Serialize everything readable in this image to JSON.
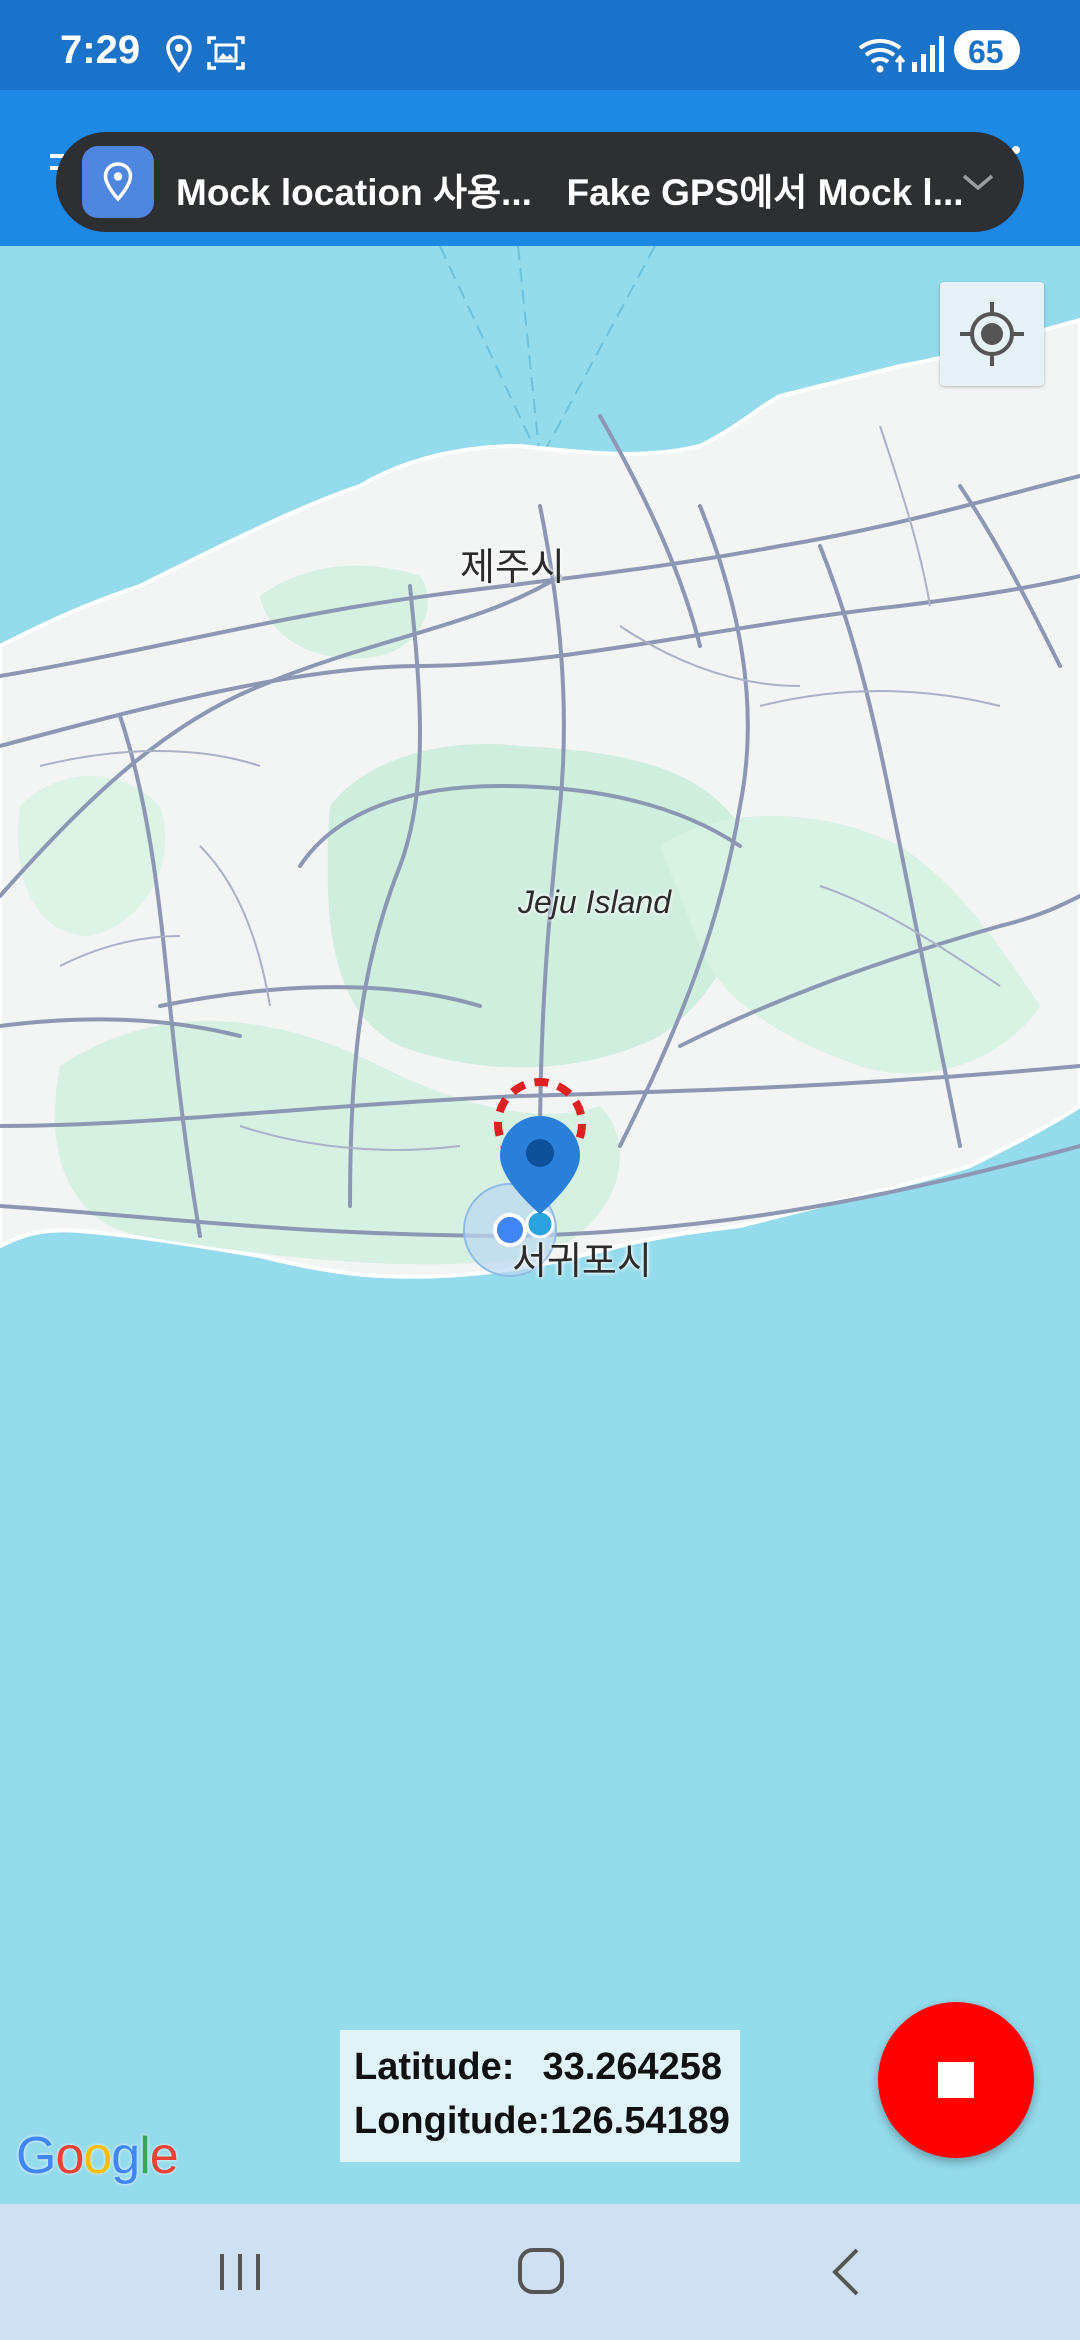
{
  "status_bar": {
    "time": "7:29",
    "battery": "65",
    "icons": [
      "location-icon",
      "screenshot-icon",
      "wifi-icon",
      "signal-icon",
      "battery-icon"
    ]
  },
  "notification": {
    "title": "Mock location 사용...",
    "text": "Fake GPS에서 Mock l...",
    "icon": "location-pin-icon"
  },
  "map": {
    "labels": {
      "jeju_si": "제주시",
      "island": "Jeju Island",
      "seogwipo_si": "서귀포시"
    },
    "attribution": "Google",
    "colors": {
      "water": "#94dbec",
      "land": "#f3f4f4",
      "park": "#cfeedd",
      "road": "#8c97b4",
      "pin": "#2a7fd9",
      "accuracy_dashes": "#e02020"
    }
  },
  "coordinates": {
    "latitude_label": "Latitude:",
    "latitude_value": "33.264258",
    "longitude_label": "Longitude:",
    "longitude_value": "126.54189"
  },
  "controls": {
    "stop_button_color": "#ff0000",
    "my_location_icon": "crosshair-icon"
  },
  "nav_bar": {
    "buttons": [
      "recents-icon",
      "home-icon",
      "back-icon"
    ]
  }
}
